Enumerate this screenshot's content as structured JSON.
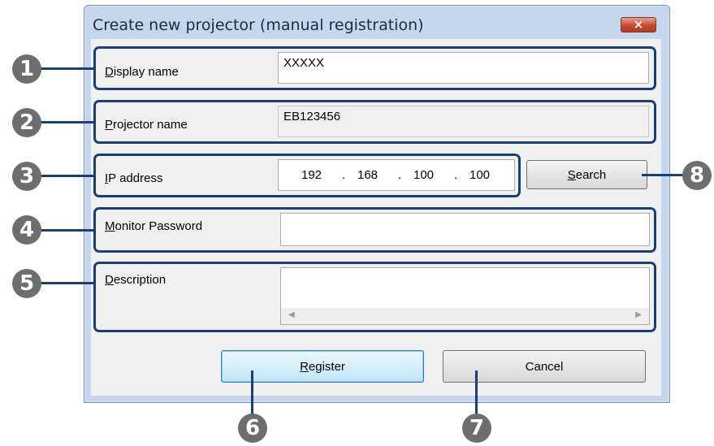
{
  "window": {
    "title": "Create new projector (manual registration)",
    "close_glyph": "×"
  },
  "display_name": {
    "label_key": "D",
    "label_rest": "isplay name",
    "value": "XXXXX"
  },
  "projector_name": {
    "label_key": "P",
    "label_rest": "rojector name",
    "value": "EB123456"
  },
  "ip_address": {
    "label_key": "I",
    "label_rest": "P address",
    "octets": [
      "192",
      "168",
      "100",
      "100"
    ],
    "separator": "."
  },
  "monitor_password": {
    "label_key": "M",
    "label_rest": "onitor Password",
    "value": ""
  },
  "description": {
    "label_key": "D",
    "label_rest": "escription",
    "value": "",
    "scroll_left_glyph": "◀",
    "scroll_right_glyph": "▶"
  },
  "buttons": {
    "search": {
      "key": "S",
      "rest": "earch"
    },
    "register": {
      "key": "R",
      "rest": "egister"
    },
    "cancel": "Cancel"
  },
  "callouts": [
    "1",
    "2",
    "3",
    "4",
    "5",
    "6",
    "7",
    "8"
  ]
}
